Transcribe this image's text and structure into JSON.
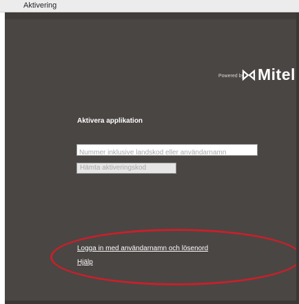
{
  "window": {
    "title": "Aktivering"
  },
  "brand": {
    "powered_by": "Powered by",
    "logo_icon": "mitel-logo-icon",
    "name": "Mitel"
  },
  "activation": {
    "heading": "Aktivera applikation",
    "phone_placeholder": "Nummer inklusive landskod eller användarnamn",
    "fetch_button": "Hämta aktiveringskod"
  },
  "links": {
    "login": "Logga in med användarnamn och lösenord",
    "help": "Hjälp"
  },
  "colors": {
    "background": "#4a4644",
    "annotation": "#c8202a",
    "text": "#ffffff"
  }
}
